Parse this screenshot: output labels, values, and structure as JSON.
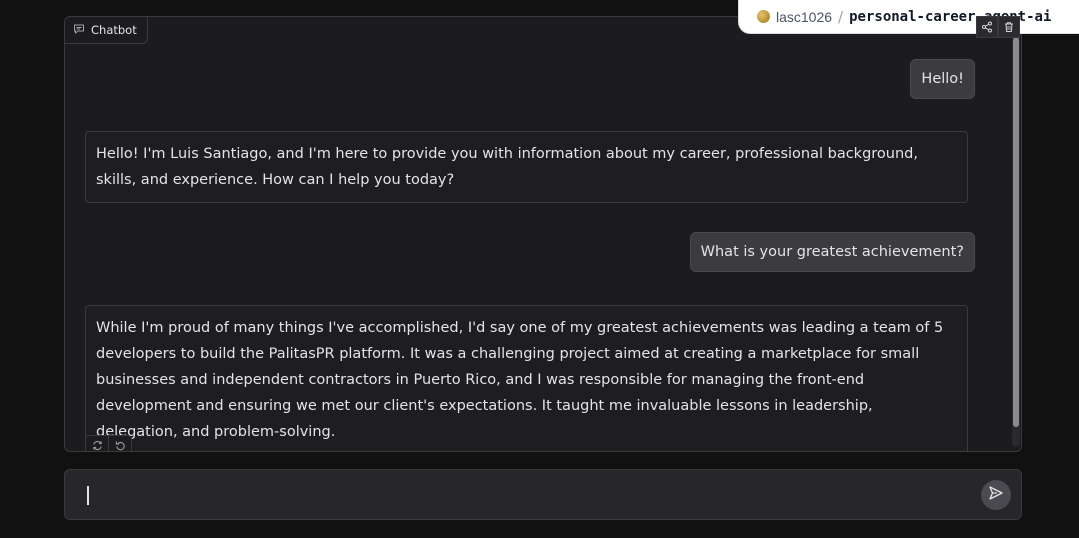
{
  "chatbot": {
    "label": "Chatbot",
    "messages": [
      {
        "role": "user",
        "text": "Hello!"
      },
      {
        "role": "assistant",
        "text": "Hello! I'm Luis Santiago, and I'm here to provide you with information about my career, professional background, skills, and experience. How can I help you today?"
      },
      {
        "role": "user",
        "text": "What is your greatest achievement?"
      },
      {
        "role": "assistant",
        "text": "While I'm proud of many things I've accomplished, I'd say one of my greatest achievements was leading a team of 5 developers to build the PalitasPR platform. It was a challenging project aimed at creating a marketplace for small businesses and independent contractors in Puerto Rico, and I was responsible for managing the front-end development and ensuring we met our client's expectations. It taught me invaluable lessons in leadership, delegation, and problem-solving."
      }
    ],
    "actions": {
      "retry_icon": "retry-icon",
      "undo_icon": "undo-icon"
    }
  },
  "space_badge": {
    "owner": "lasc1026",
    "separator": "/",
    "repo": "personal-career-agent-ai"
  },
  "panel_tools": {
    "share_icon": "share-icon",
    "trash_icon": "trash-icon"
  },
  "input": {
    "value": "",
    "placeholder": ""
  },
  "send_icon": "send-icon",
  "colors": {
    "background": "#111112",
    "panel": "#1c1c1f",
    "user_bubble": "#3b3b40",
    "badge_bg": "#ffffff"
  }
}
